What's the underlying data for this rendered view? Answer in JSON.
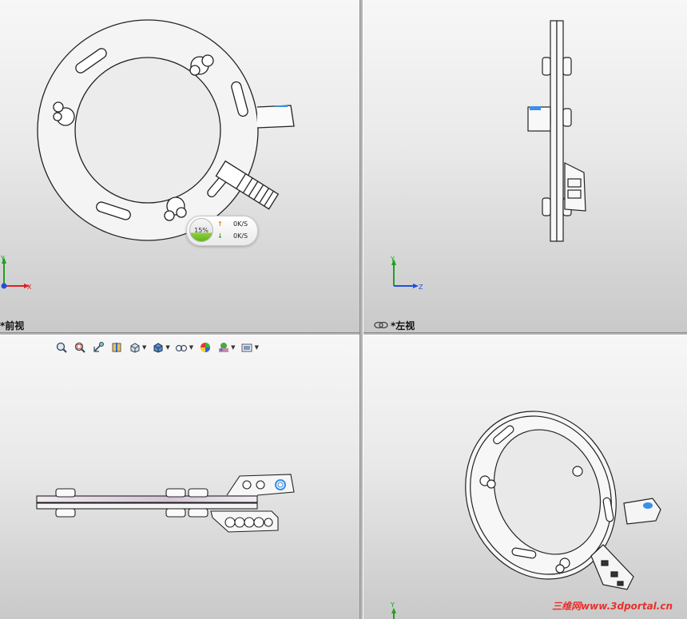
{
  "viewports": {
    "front": {
      "label": "*前视",
      "triad": {
        "horizontal": "X",
        "vertical": "Y"
      }
    },
    "left": {
      "label": "*左视",
      "triad": {
        "horizontal": "Z",
        "vertical": "Y"
      }
    },
    "top": {
      "label": "",
      "triad": {}
    },
    "iso": {
      "label": "",
      "triad": {
        "vertical": "Y"
      }
    }
  },
  "toolbar": {
    "icons": [
      "zoom-to-fit-icon",
      "zoom-area-icon",
      "previous-view-icon",
      "section-view-icon",
      "view-orientation-icon",
      "display-style-icon",
      "hide-show-items-icon",
      "edit-appearance-icon",
      "apply-scene-icon",
      "view-settings-icon"
    ]
  },
  "network_widget": {
    "percent": "15%",
    "upload_rate": "0K/S",
    "download_rate": "0K/S",
    "upload_arrow": "↑",
    "download_arrow": "↓",
    "upload_color": "#e07a14",
    "download_color": "#3a9a2a"
  },
  "watermark": "三维网www.3dportal.cn",
  "colors": {
    "axis_x": "#e02020",
    "axis_y": "#20a020",
    "axis_z": "#2050e0",
    "highlight": "#3a8fe8"
  }
}
